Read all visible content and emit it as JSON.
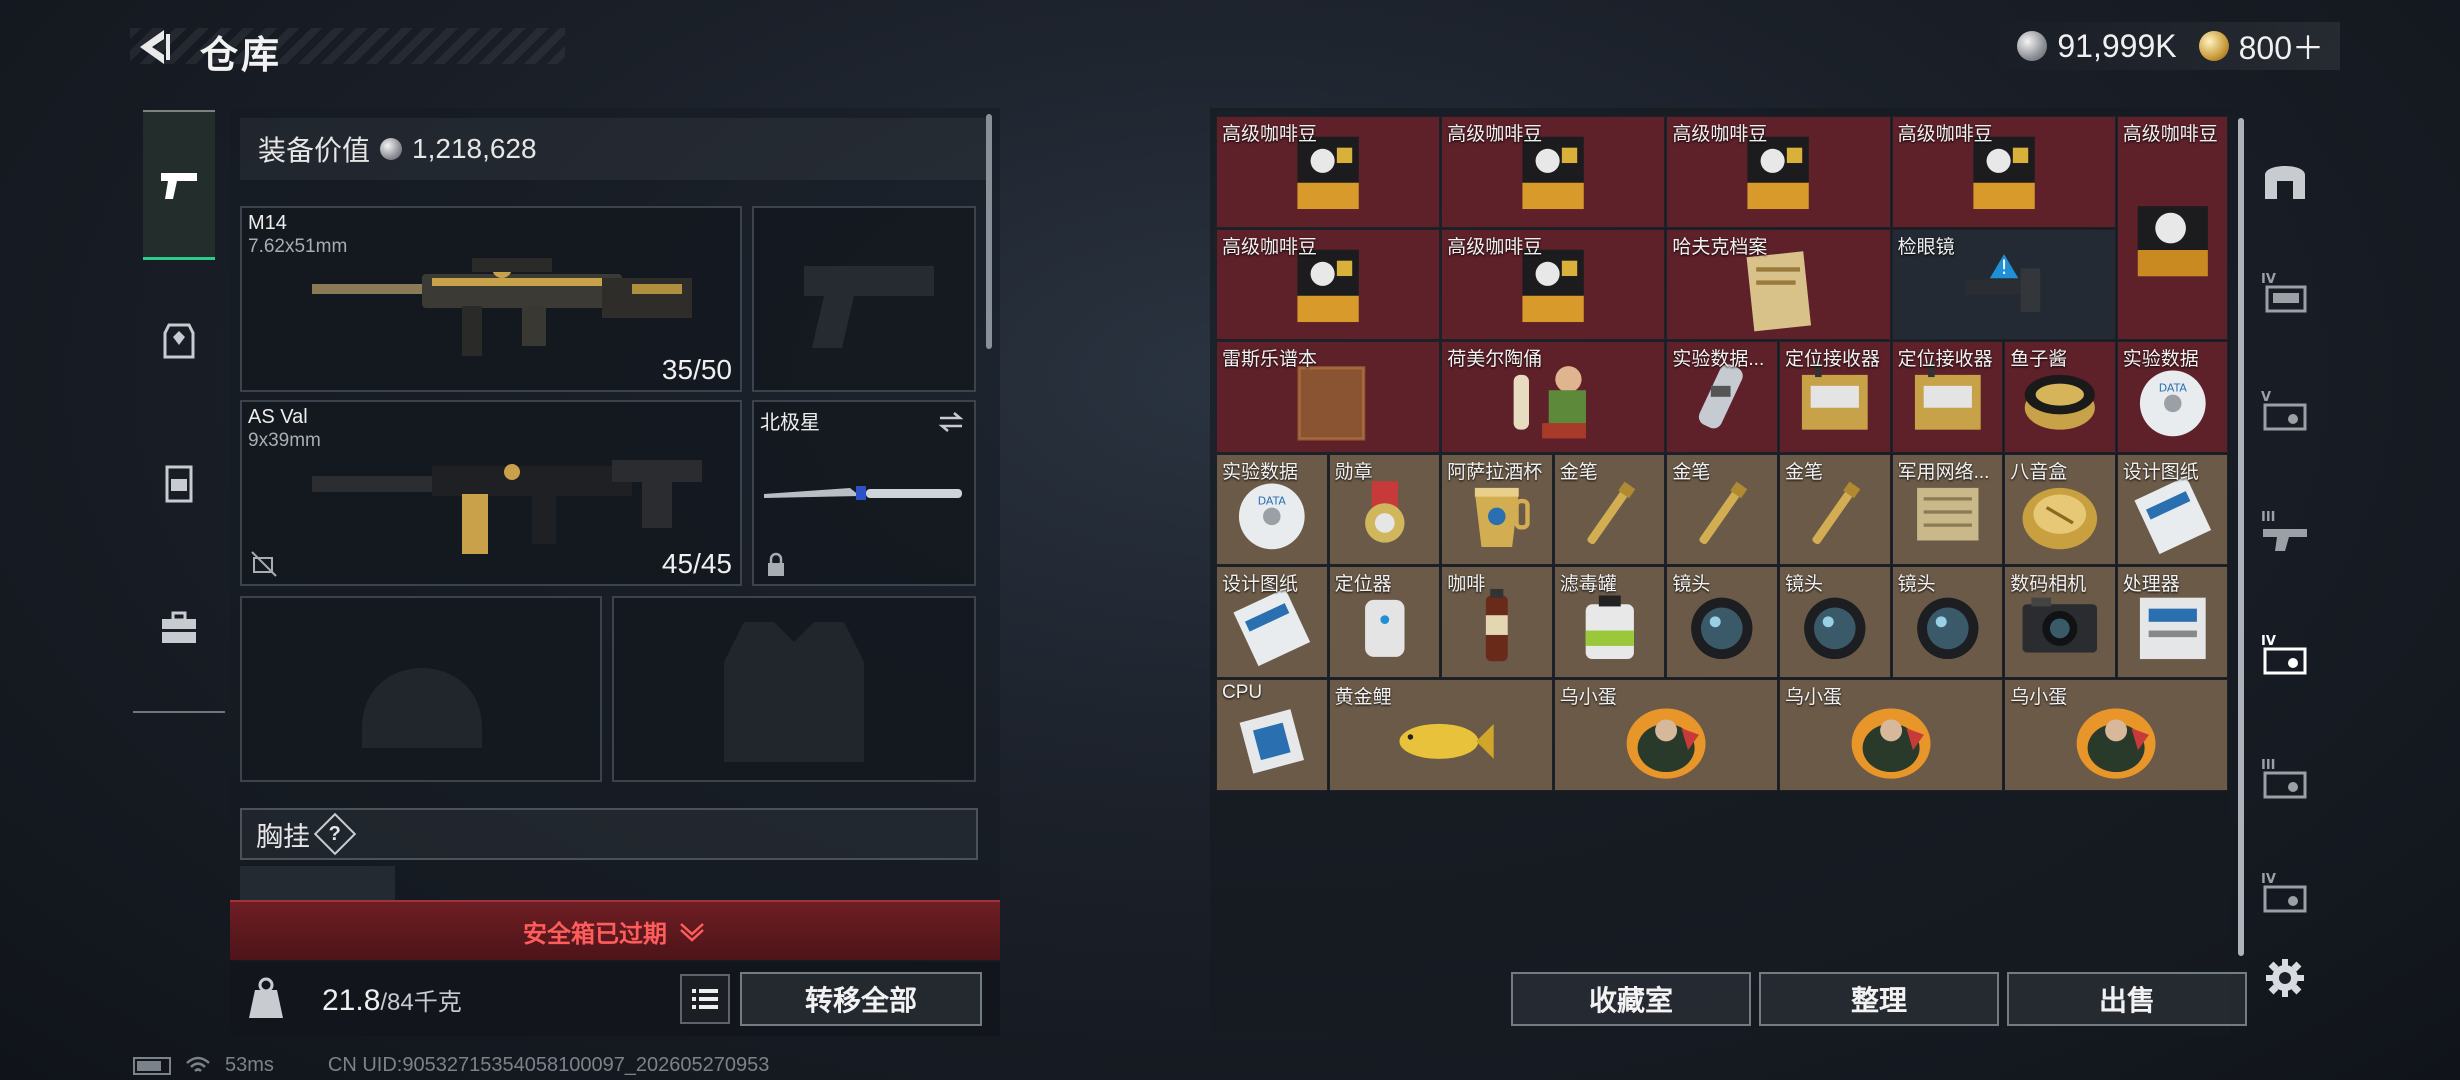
{
  "header": {
    "title": "仓库",
    "silver_amount": "91,999K",
    "gold_amount": "800＋"
  },
  "equipment": {
    "value_label": "装备价值",
    "value": "1,218,628",
    "primary_weapon": {
      "name": "M14",
      "caliber": "7.62x51mm",
      "ammo": "35/50"
    },
    "secondary_weapon": {
      "name": "AS Val",
      "caliber": "9x39mm",
      "ammo": "45/45"
    },
    "melee": {
      "name": "北极星"
    },
    "chest_rig_label": "胸挂",
    "help_mark": "?",
    "safe_box_status": "安全箱已过期",
    "weight_current": "21.8",
    "weight_max": "/84千克",
    "transfer_all_label": "转移全部"
  },
  "stash": {
    "items": [
      {
        "label": "高级咖啡豆",
        "bg": "red",
        "icon": "coffee-bag"
      },
      {
        "label": "高级咖啡豆",
        "bg": "red",
        "icon": "coffee-bag"
      },
      {
        "label": "高级咖啡豆",
        "bg": "red",
        "icon": "coffee-bag"
      },
      {
        "label": "高级咖啡豆",
        "bg": "red",
        "icon": "coffee-bag"
      },
      {
        "label": "高级咖啡豆",
        "bg": "red",
        "icon": "coffee-bag-tall"
      },
      {
        "label": "高级咖啡豆",
        "bg": "red",
        "icon": "coffee-bag"
      },
      {
        "label": "高级咖啡豆",
        "bg": "red",
        "icon": "coffee-bag"
      },
      {
        "label": "哈夫克档案",
        "bg": "red",
        "icon": "document"
      },
      {
        "label": "检眼镜",
        "bg": "dark",
        "icon": "scope"
      },
      {
        "label": "雷斯乐谱本",
        "bg": "red",
        "icon": "book"
      },
      {
        "label": "荷美尔陶俑",
        "bg": "red",
        "icon": "figurine"
      },
      {
        "label": "实验数据...",
        "bg": "red",
        "icon": "data-tube"
      },
      {
        "label": "定位接收器",
        "bg": "red",
        "icon": "receiver"
      },
      {
        "label": "定位接收器",
        "bg": "red",
        "icon": "receiver"
      },
      {
        "label": "鱼子酱",
        "bg": "red",
        "icon": "caviar"
      },
      {
        "label": "实验数据",
        "bg": "red",
        "icon": "disc"
      },
      {
        "label": "实验数据",
        "bg": "gold",
        "icon": "disc"
      },
      {
        "label": "勋章",
        "bg": "gold",
        "icon": "medal"
      },
      {
        "label": "阿萨拉酒杯",
        "bg": "gold",
        "icon": "cup"
      },
      {
        "label": "金笔",
        "bg": "gold",
        "icon": "pen"
      },
      {
        "label": "金笔",
        "bg": "gold",
        "icon": "pen"
      },
      {
        "label": "金笔",
        "bg": "gold",
        "icon": "pen"
      },
      {
        "label": "军用网络...",
        "bg": "gold",
        "icon": "network-box"
      },
      {
        "label": "八音盒",
        "bg": "gold",
        "icon": "music-box"
      },
      {
        "label": "设计图纸",
        "bg": "gold",
        "icon": "blueprint"
      },
      {
        "label": "设计图纸",
        "bg": "gold",
        "icon": "blueprint"
      },
      {
        "label": "定位器",
        "bg": "gold",
        "icon": "tracker"
      },
      {
        "label": "咖啡",
        "bg": "gold",
        "icon": "coffee-bottle"
      },
      {
        "label": "滤毒罐",
        "bg": "gold",
        "icon": "filter-can"
      },
      {
        "label": "镜头",
        "bg": "gold",
        "icon": "lens"
      },
      {
        "label": "镜头",
        "bg": "gold",
        "icon": "lens"
      },
      {
        "label": "镜头",
        "bg": "gold",
        "icon": "lens"
      },
      {
        "label": "数码相机",
        "bg": "gold",
        "icon": "camera"
      },
      {
        "label": "处理器",
        "bg": "gold",
        "icon": "processor-box"
      },
      {
        "label": "CPU",
        "bg": "gold",
        "icon": "cpu"
      },
      {
        "label": "黄金鲤",
        "bg": "gold",
        "icon": "fish"
      },
      {
        "label": "乌小蛋",
        "bg": "gold",
        "icon": "egg-toy"
      },
      {
        "label": "乌小蛋",
        "bg": "gold",
        "icon": "egg-toy"
      },
      {
        "label": "乌小蛋",
        "bg": "gold",
        "icon": "egg-toy"
      }
    ],
    "collection_button": "收藏室",
    "organize_button": "整理",
    "sell_button": "出售"
  },
  "status": {
    "ping": "53ms",
    "uid": "CN UID:9053271535405810009​7_202605270953"
  },
  "colors": {
    "gold_cell": "#6b5a48",
    "red_cell": "#5e2029",
    "dark_cell": "#242a33",
    "active_tab": "#2ecc8a",
    "warning": "#ff5c5c"
  }
}
